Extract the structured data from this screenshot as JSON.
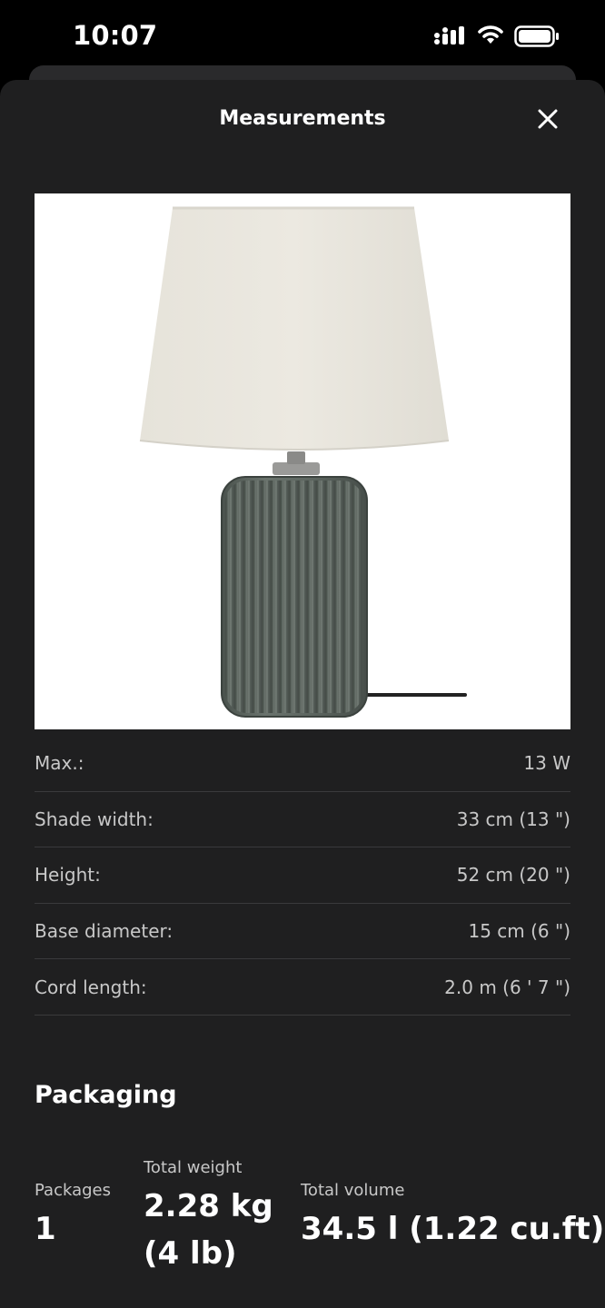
{
  "status_bar": {
    "time": "10:07",
    "icons": [
      "cellular-signal-icon",
      "wifi-icon",
      "battery-icon"
    ]
  },
  "sheet": {
    "title": "Measurements",
    "close_icon": "close-icon"
  },
  "product_image": {
    "subject": "table lamp",
    "shade_color": "#e9e6de",
    "base_color": "#5b645e"
  },
  "specs": [
    {
      "label": "Max.:",
      "value": "13 W"
    },
    {
      "label": "Shade width:",
      "value": "33 cm (13 \")"
    },
    {
      "label": "Height:",
      "value": "52 cm (20 \")"
    },
    {
      "label": "Base diameter:",
      "value": "15 cm (6 \")"
    },
    {
      "label": "Cord length:",
      "value": "2.0 m (6 ' 7 \")"
    }
  ],
  "packaging": {
    "title": "Packaging",
    "packages": {
      "label": "Packages",
      "value": "1"
    },
    "total_weight": {
      "label": "Total weight",
      "value_line1": "2.28 kg",
      "value_line2": "(4 lb)"
    },
    "total_volume": {
      "label": "Total volume",
      "value": "34.5 l (1.22 cu.ft)"
    }
  },
  "colors": {
    "sheet_background": "#1f1f20",
    "divider": "#3a3a3c",
    "secondary_text": "#c8c8c8"
  }
}
